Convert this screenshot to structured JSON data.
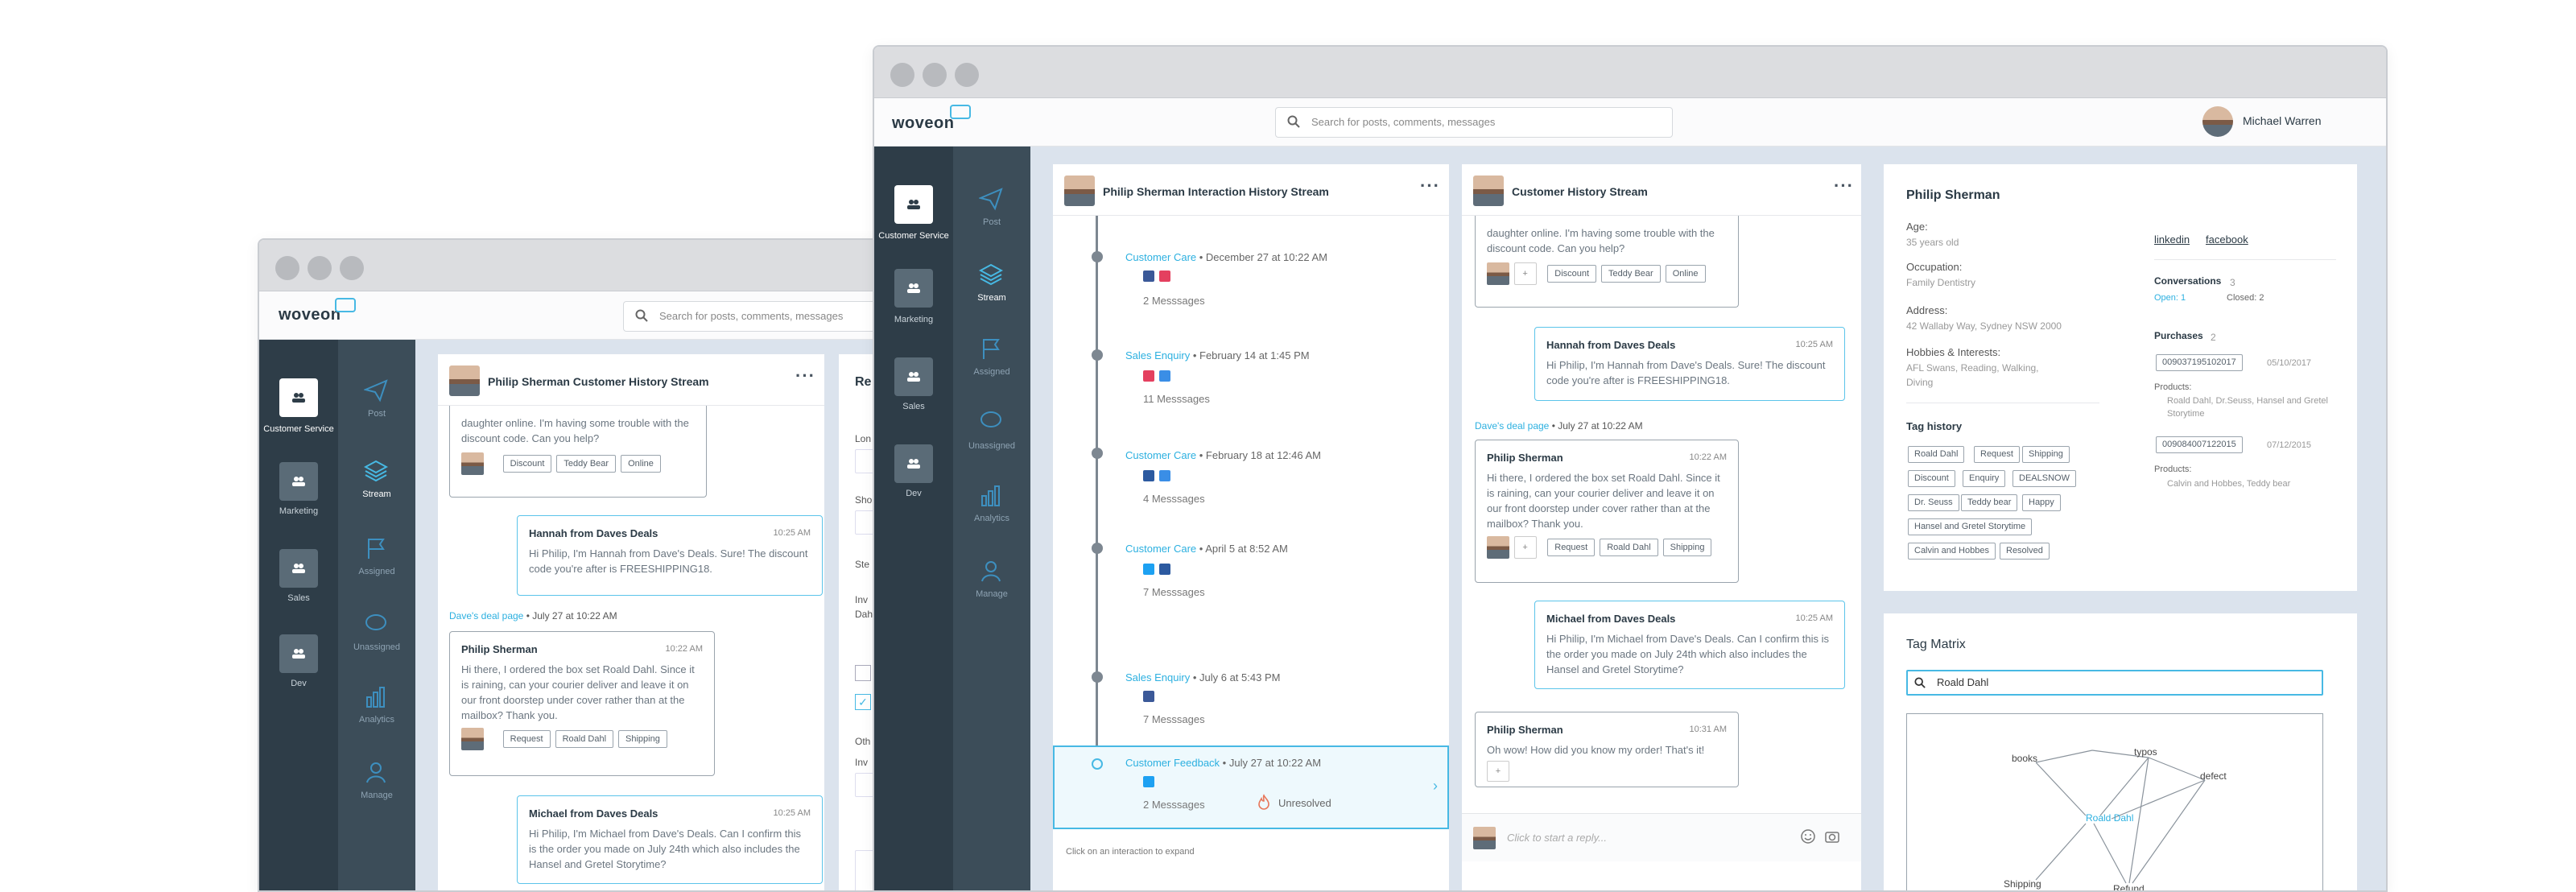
{
  "back_window": {
    "logo": "woveon",
    "search_placeholder": "Search for posts, comments, messages",
    "nav": [
      {
        "label": "Customer Service"
      },
      {
        "label": "Marketing"
      },
      {
        "label": "Sales"
      },
      {
        "label": "Dev"
      }
    ],
    "nav2": [
      {
        "label": "Post"
      },
      {
        "label": "Stream"
      },
      {
        "label": "Assigned"
      },
      {
        "label": "Unassigned"
      },
      {
        "label": "Analytics"
      },
      {
        "label": "Manage"
      }
    ],
    "stream_title": "Philip Sherman Customer History Stream",
    "right_panel_title": "Re",
    "right_panel_fields": [
      "Ste",
      "Lon",
      "Sho",
      "Ste",
      "Inv",
      "Dah",
      "Oth",
      "Inv"
    ],
    "messages": [
      {
        "text": "daughter online. I'm having some trouble with the discount code. Can you help?",
        "tags": [
          "Discount",
          "Teddy Bear",
          "Online"
        ]
      },
      {
        "who": "Hannah from Daves Deals",
        "time": "10:25 AM",
        "text": "Hi Philip, I'm Hannah from Dave's Deals. Sure! The discount code you're after is FREESHIPPING18."
      },
      {
        "source": "Dave's deal page",
        "date": "July 27 at 10:22 AM"
      },
      {
        "who": "Philip Sherman",
        "time": "10:22 AM",
        "text": "Hi there, I ordered the box set Roald Dahl. Since it is raining, can your courier deliver and leave it on our front doorstep under cover rather than at the mailbox? Thank you.",
        "tags": [
          "Request",
          "Roald Dahl",
          "Shipping"
        ]
      },
      {
        "who": "Michael from Daves Deals",
        "time": "10:25 AM",
        "text": "Hi Philip, I'm Michael from Dave's Deals. Can I confirm this is the order you made on July 24th which also includes the Hansel and Gretel Storytime?"
      }
    ]
  },
  "front_window": {
    "logo": "woveon",
    "search_placeholder": "Search for posts, comments, messages",
    "user_name": "Michael Warren",
    "nav": [
      {
        "label": "Customer Service"
      },
      {
        "label": "Marketing"
      },
      {
        "label": "Sales"
      },
      {
        "label": "Dev"
      }
    ],
    "nav2": [
      {
        "label": "Post"
      },
      {
        "label": "Stream"
      },
      {
        "label": "Assigned"
      },
      {
        "label": "Unassigned"
      },
      {
        "label": "Analytics"
      },
      {
        "label": "Manage"
      }
    ],
    "interaction_stream": {
      "title": "Philip Sherman Interaction History Stream",
      "items": [
        {
          "channel": "Customer Care",
          "date": "December 27 at 10:22 AM",
          "messages": "2 Messsages"
        },
        {
          "channel": "Sales Enquiry",
          "date": "February 14 at 1:45 PM",
          "messages": "11 Messsages"
        },
        {
          "channel": "Customer Care",
          "date": "February 18 at 12:46 AM",
          "messages": "4 Messsages"
        },
        {
          "channel": "Customer Care",
          "date": "April 5 at 8:52 AM",
          "messages": "7 Messsages"
        },
        {
          "channel": "Sales Enquiry",
          "date": "July 6 at 5:43 PM",
          "messages": "7 Messsages"
        },
        {
          "channel": "Customer Feedback",
          "date": "July 27 at 10:22 AM",
          "messages": "2 Messsages",
          "status": "Unresolved"
        }
      ],
      "footer": "Click on an interaction to expand"
    },
    "history_stream": {
      "title": "Customer History Stream",
      "messages": [
        {
          "text": "daughter online. I'm having some trouble with the discount code. Can you help?",
          "tags": [
            "Discount",
            "Teddy Bear",
            "Online"
          ]
        },
        {
          "who": "Hannah from Daves Deals",
          "time": "10:25 AM",
          "text": "Hi Philip, I'm Hannah from Dave's Deals. Sure! The discount code you're after is FREESHIPPING18."
        },
        {
          "source": "Dave's deal page",
          "date": "July 27 at 10:22 AM"
        },
        {
          "who": "Philip Sherman",
          "time": "10:22 AM",
          "text": "Hi there, I ordered the box set Roald Dahl. Since it is raining, can your courier deliver and leave it on our front doorstep under cover rather than at the mailbox? Thank you.",
          "tags": [
            "Request",
            "Roald Dahl",
            "Shipping"
          ]
        },
        {
          "who": "Michael from Daves Deals",
          "time": "10:25 AM",
          "text": "Hi Philip, I'm Michael from Dave's Deals. Can I confirm this is the order you made on July 24th which also includes the Hansel and Gretel Storytime?"
        },
        {
          "who": "Philip Sherman",
          "time": "10:31 AM",
          "text": "Oh wow! How did you know my order! That's it!"
        }
      ],
      "reply_placeholder": "Click to start a reply..."
    },
    "profile": {
      "name": "Philip Sherman",
      "age_label": "Age:",
      "age": "35 years old",
      "occupation_label": "Occupation:",
      "occupation": "Family Dentistry",
      "address_label": "Address:",
      "address": "42 Wallaby Way, Sydney NSW 2000",
      "hobbies_label": "Hobbies & Interests:",
      "hobbies": "AFL Swans, Reading, Walking, Diving",
      "links": [
        "linkedin",
        "facebook"
      ],
      "conversations_label": "Conversations",
      "conversations_count": "3",
      "open": "Open: 1",
      "closed": "Closed: 2",
      "purchases_label": "Purchases",
      "purchases_count": "2",
      "purchases": [
        {
          "id": "009037195102017",
          "date": "05/10/2017",
          "products_label": "Products:",
          "products": "Roald Dahl, Dr.Seuss, Hansel and Gretel Storytime"
        },
        {
          "id": "009084007122015",
          "date": "07/12/2015",
          "products_label": "Products:",
          "products": "Calvin and Hobbes, Teddy bear"
        }
      ],
      "tag_history_label": "Tag history",
      "tag_history": [
        "Roald Dahl",
        "Request",
        "Shipping",
        "Discount",
        "Enquiry",
        "DEALSNOW",
        "Dr. Seuss",
        "Teddy bear",
        "Happy",
        "Hansel and Gretel Storytime",
        "Calvin and Hobbes",
        "Resolved"
      ]
    },
    "tag_matrix": {
      "title": "Tag Matrix",
      "search_value": "Roald Dahl",
      "nodes": [
        "books",
        "typos",
        "defect",
        "Roald Dahl",
        "Shipping",
        "Refund"
      ],
      "center": "Roald Dahl"
    }
  }
}
